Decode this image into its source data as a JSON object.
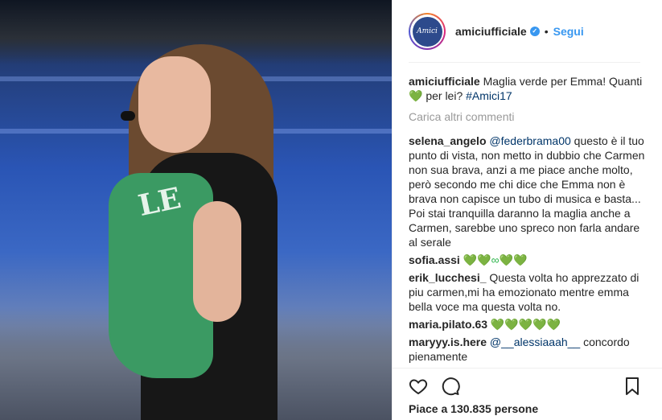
{
  "header": {
    "username": "amiciufficiale",
    "verified_mark": "✓",
    "separator": "•",
    "follow_label": "Segui",
    "avatar_text": "Amici"
  },
  "photo": {
    "sweater_text": "LE",
    "alt": ""
  },
  "caption": {
    "username": "amiciufficiale",
    "text": "Maglia verde per Emma! Quanti ",
    "heart": "💚",
    "text_after": " per lei? ",
    "hashtag": "#Amici17"
  },
  "load_more": "Carica altri commenti",
  "comments": [
    {
      "username": "selena_angelo",
      "mention": "@federbrama00",
      "text": " questo è il tuo punto di vista, non metto in dubbio che Carmen non sua brava, anzi a me piace anche molto, però secondo me chi dice che Emma non è brava non capisce un tubo di musica e basta... Poi stai tranquilla daranno la maglia anche a Carmen, sarebbe uno spreco non farla andare al serale"
    },
    {
      "username": "sofia.assi",
      "mention": "",
      "text": " 💚💚∞💚💚"
    },
    {
      "username": "erik_lucchesi_",
      "mention": "",
      "text": " Questa volta ho apprezzato di piu carmen,mi ha emozionato mentre emma bella voce ma questa volta no."
    },
    {
      "username": "maria.pilato.63",
      "mention": "",
      "text": " 💚💚💚💚💚"
    },
    {
      "username": "maryyy.is.here",
      "mention": "@__alessiaaah__",
      "text": " concordo pienamente"
    }
  ],
  "actions": {
    "like_icon": "heart-outline-icon",
    "comment_icon": "comment-bubble-icon",
    "save_icon": "bookmark-icon"
  },
  "likes": {
    "prefix": "Piace a ",
    "count": "130.835",
    "suffix": " persone"
  },
  "colors": {
    "link": "#003569",
    "follow": "#3897f0",
    "muted": "#999999",
    "text": "#262626",
    "border": "#efefef"
  }
}
